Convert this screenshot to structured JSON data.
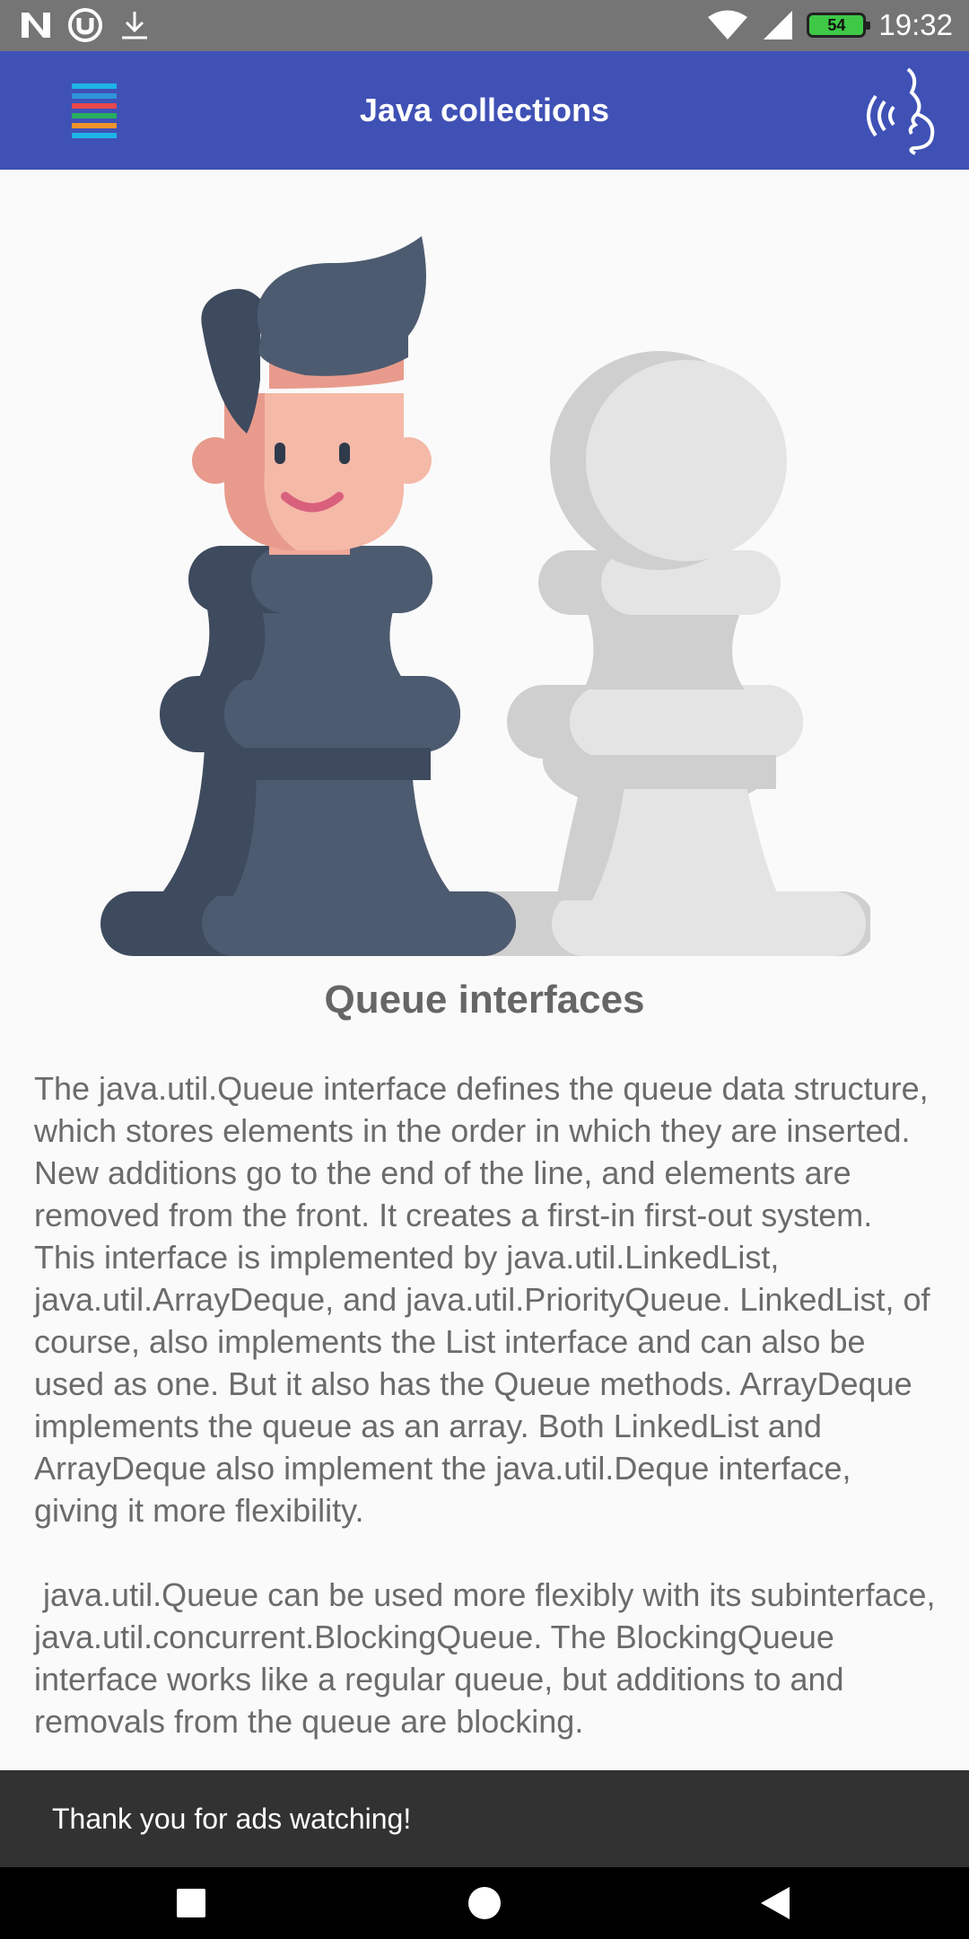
{
  "status_bar": {
    "time": "19:32",
    "battery_level": "54",
    "icons": [
      "n-notification-icon",
      "utorrent-icon",
      "download-icon",
      "wifi-icon",
      "signal-icon",
      "battery-icon"
    ]
  },
  "app_bar": {
    "title": "Java collections",
    "menu_icon": "menu-icon",
    "speak_icon": "text-to-speech-icon"
  },
  "content": {
    "illustration": "chess-king-and-pawn-illustration",
    "section_title": "Queue interfaces",
    "paragraphs": [
      "The java.util.Queue interface defines the queue data structure, which stores elements in the order in which they are inserted. New additions go to the end of the line, and elements are removed from the front. It creates a first-in first-out system. This interface is implemented by java.util.LinkedList, java.util.ArrayDeque, and java.util.PriorityQueue. LinkedList, of course, also implements the List interface and can also be used as one. But it also has the Queue methods. ArrayDeque implements the queue as an array. Both LinkedList and ArrayDeque also implement the java.util.Deque interface, giving it more flexibility.",
      " java.util.Queue can be used more flexibly with its subinterface, java.util.concurrent.BlockingQueue. The BlockingQueue interface works like a regular queue, but additions to and removals from the queue are blocking."
    ]
  },
  "snackbar": {
    "message": "Thank you for ads watching!"
  },
  "nav_bar": {
    "buttons": [
      "recents-square-icon",
      "home-circle-icon",
      "back-triangle-icon"
    ]
  },
  "colors": {
    "status_bar": "#757575",
    "app_bar": "#3f51b5",
    "background": "#fafafa",
    "text": "#6b6b6b",
    "snackbar": "#323232",
    "menu_stripes": [
      "#1eb4e6",
      "#2f95d8",
      "#e8484b",
      "#27ae60",
      "#f0932b",
      "#1eb4e6"
    ]
  }
}
